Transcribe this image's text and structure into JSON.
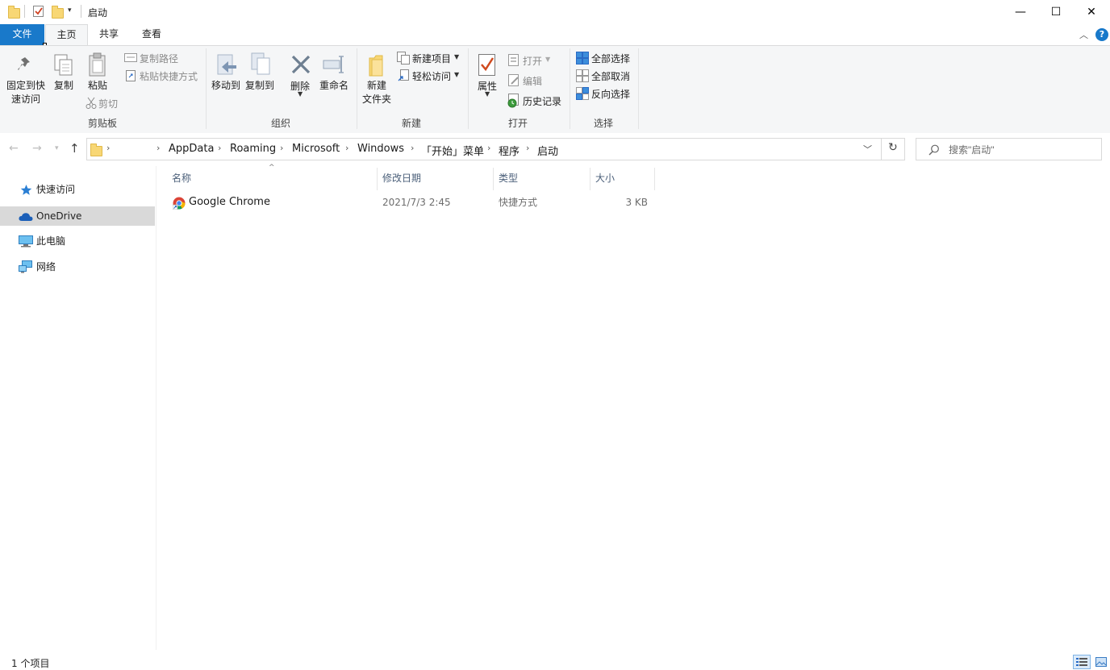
{
  "window": {
    "title": "启动",
    "minimize": "—",
    "maximize": "☐",
    "close": "✕"
  },
  "ribbon_tabs": [
    "文件",
    "主页",
    "共享",
    "查看"
  ],
  "ribbon": {
    "clipboard": {
      "pin_line1": "固定到快",
      "pin_line2": "速访问",
      "copy": "复制",
      "paste": "粘贴",
      "copy_path": "复制路径",
      "paste_shortcut": "粘贴快捷方式",
      "cut": "剪切",
      "label": "剪贴板"
    },
    "organize": {
      "move_to": "移动到",
      "copy_to": "复制到",
      "delete": "删除",
      "rename": "重命名",
      "label": "组织"
    },
    "new": {
      "new_folder_line1": "新建",
      "new_folder_line2": "文件夹",
      "new_item": "新建项目",
      "easy_access": "轻松访问",
      "label": "新建"
    },
    "open": {
      "properties": "属性",
      "open": "打开",
      "edit": "编辑",
      "history": "历史记录",
      "label": "打开"
    },
    "select": {
      "select_all": "全部选择",
      "select_none": "全部取消",
      "invert": "反向选择",
      "label": "选择"
    }
  },
  "address": {
    "crumbs": [
      "AppData",
      "Roaming",
      "Microsoft",
      "Windows",
      "「开始」菜单",
      "程序",
      "启动"
    ]
  },
  "search": {
    "placeholder": "搜索\"启动\""
  },
  "nav_pane": [
    {
      "label": "快速访问",
      "icon": "star-icon",
      "selected": false
    },
    {
      "label": "OneDrive",
      "icon": "cloud-icon",
      "selected": true
    },
    {
      "label": "此电脑",
      "icon": "computer-icon",
      "selected": false
    },
    {
      "label": "网络",
      "icon": "network-icon",
      "selected": false
    }
  ],
  "columns": {
    "name": "名称",
    "modified": "修改日期",
    "type": "类型",
    "size": "大小"
  },
  "files": [
    {
      "name": "Google Chrome",
      "modified": "2021/7/3 2:45",
      "type": "快捷方式",
      "size": "3 KB",
      "icon": "chrome-icon"
    }
  ],
  "status": {
    "count": "1 个项目"
  },
  "colors": {
    "file_tab": "#1979ca",
    "ribbon_bg": "#f5f6f7",
    "selection": "#d9d9d9",
    "column_header": "#4c607a"
  }
}
